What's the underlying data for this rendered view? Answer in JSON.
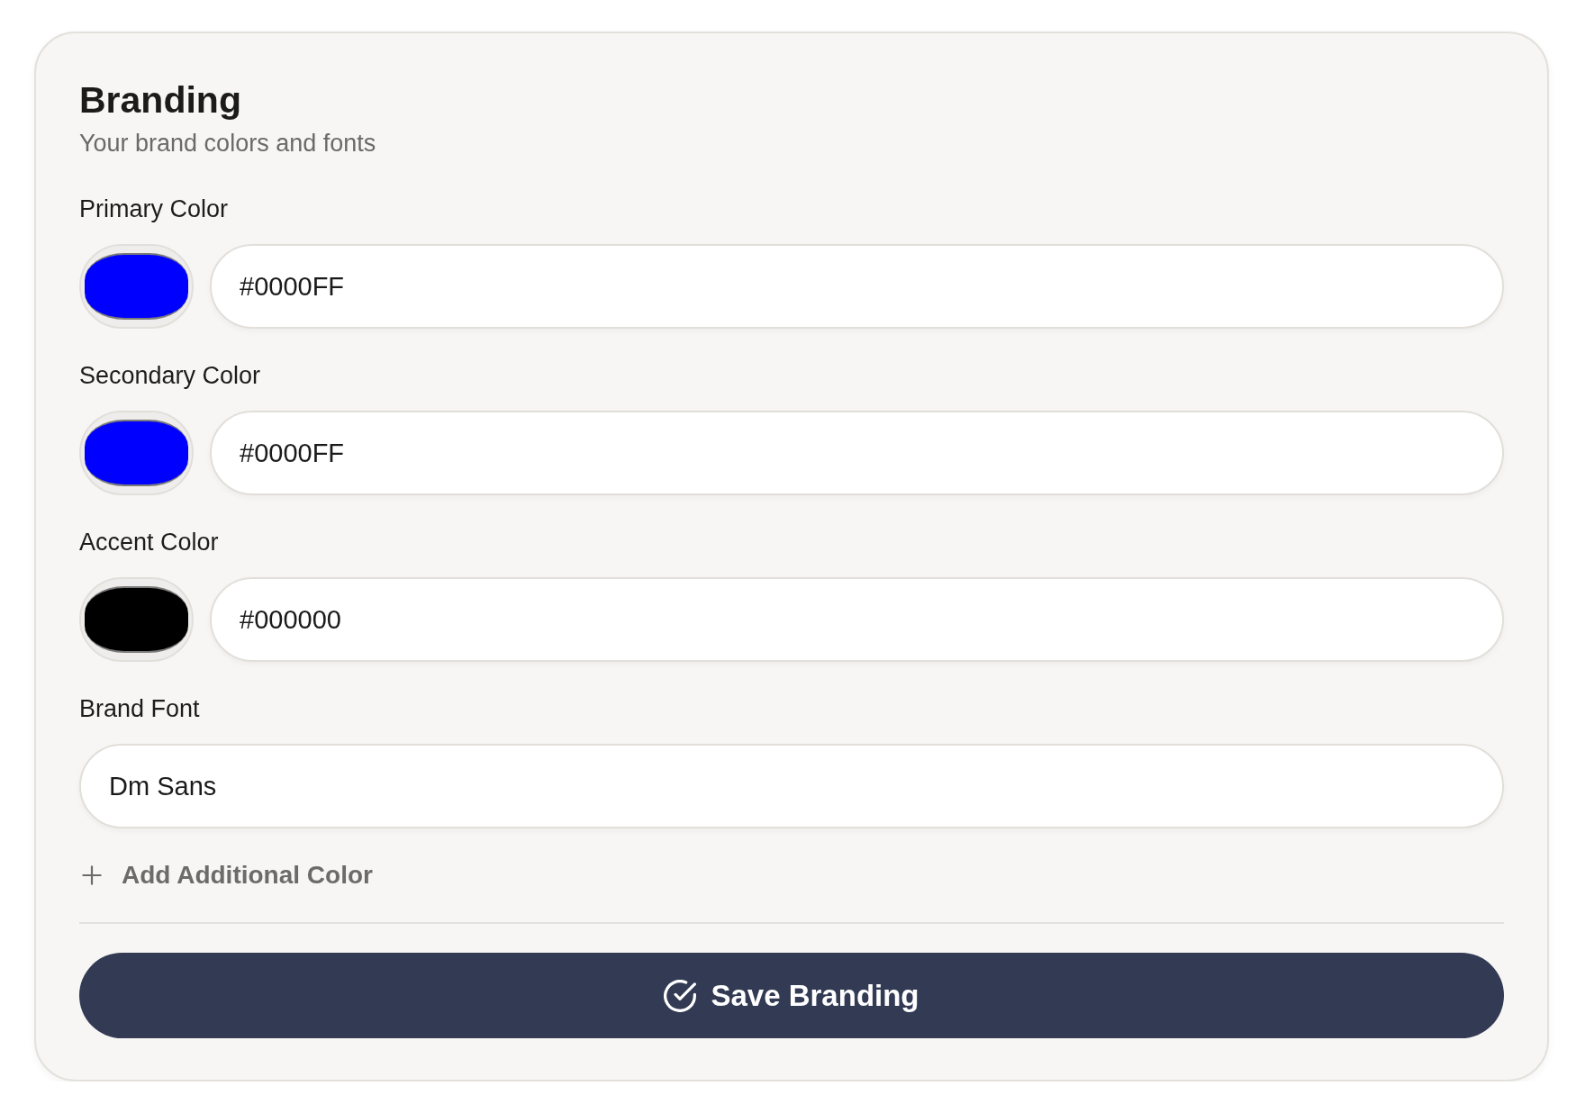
{
  "header": {
    "title": "Branding",
    "subtitle": "Your brand colors and fonts"
  },
  "fields": [
    {
      "kind": "color",
      "label": "Primary Color",
      "value": "#0000FF",
      "color": "#0000ff"
    },
    {
      "kind": "color",
      "label": "Secondary Color",
      "value": "#0000FF",
      "color": "#0000ff"
    },
    {
      "kind": "color",
      "label": "Accent Color",
      "value": "#000000",
      "color": "#000000"
    },
    {
      "kind": "text",
      "label": "Brand Font",
      "value": "Dm Sans"
    }
  ],
  "add_button": {
    "label": "Add Additional Color"
  },
  "save_button": {
    "label": "Save Branding"
  }
}
